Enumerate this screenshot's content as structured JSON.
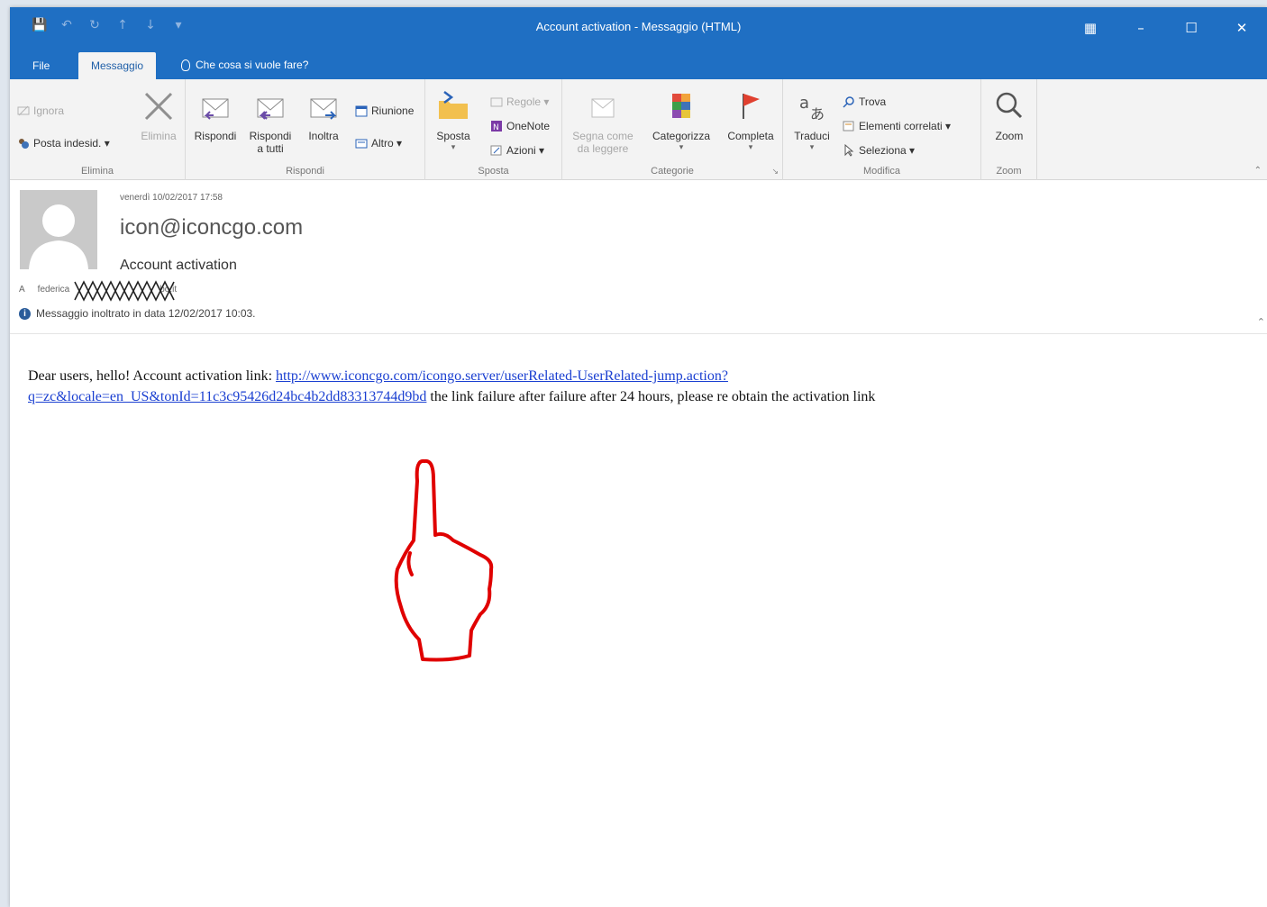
{
  "window": {
    "title": "Account activation  -  Messaggio (HTML)"
  },
  "tabs": {
    "file": "File",
    "message": "Messaggio",
    "tell_me": "Che cosa si vuole fare?"
  },
  "ribbon": {
    "elimina": {
      "ignora": "Ignora",
      "posta_indesid": "Posta indesid. ▾",
      "elimina_btn": "Elimina",
      "label": "Elimina"
    },
    "rispondi": {
      "rispondi": "Rispondi",
      "rispondi_tutti_1": "Rispondi",
      "rispondi_tutti_2": "a tutti",
      "inoltra": "Inoltra",
      "riunione": "Riunione",
      "altro": "Altro ▾",
      "label": "Rispondi"
    },
    "sposta": {
      "sposta": "Sposta",
      "regole": "Regole ▾",
      "onenote": "OneNote",
      "azioni": "Azioni ▾",
      "label": "Sposta"
    },
    "categorie": {
      "segna_1": "Segna come",
      "segna_2": "da leggere",
      "categorizza": "Categorizza",
      "completa": "Completa",
      "label": "Categorie"
    },
    "modifica": {
      "traduci": "Traduci",
      "trova": "Trova",
      "elementi_correlati": "Elementi correlati ▾",
      "seleziona": "Seleziona ▾",
      "label": "Modifica"
    },
    "zoom": {
      "zoom": "Zoom",
      "label": "Zoom"
    }
  },
  "message": {
    "date": "venerdì 10/02/2017 17:58",
    "sender": "icon@iconcgo.com",
    "subject": "Account activation",
    "to_prefix": "A",
    "to_visible": "federica",
    "to_suffix": "bo.it",
    "info_text": "Messaggio inoltrato in data 12/02/2017 10:03.",
    "body_intro": "Dear users, hello! Account activation link: ",
    "body_link_line1": "http://www.iconcgo.com/icongo.server/userRelated-UserRelated-jump.action?",
    "body_link_line2": "q=zc&locale=en_US&tonId=11c3c95426d24bc4b2dd83313744d9bd",
    "body_outro": " the link failure after failure after 24 hours, please re obtain the activation link"
  },
  "colors": {
    "titlebar": "#1f6fc3",
    "ribbon": "#f3f3f3",
    "link": "#1a3fd1",
    "hand_annotation": "#e00000"
  }
}
